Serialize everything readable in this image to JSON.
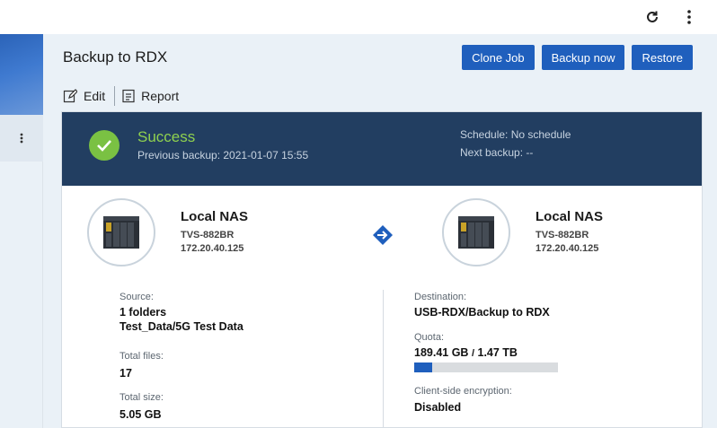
{
  "topbar": {
    "icons": [
      "refresh-icon",
      "more-vertical-icon"
    ]
  },
  "sidebar": {
    "menu_icon": "more-vertical-icon"
  },
  "job": {
    "title": "Backup to RDX",
    "actions": {
      "clone": "Clone Job",
      "backup_now": "Backup now",
      "restore": "Restore"
    },
    "tools": {
      "edit": "Edit",
      "report": "Report"
    }
  },
  "status": {
    "title": "Success",
    "previous_backup": "Previous backup: 2021-01-07 15:55",
    "schedule": "Schedule: No schedule",
    "next_backup": "Next backup: --",
    "color": "#7ac143"
  },
  "source_node": {
    "name": "Local NAS",
    "model": "TVS-882BR",
    "ip": "172.20.40.125"
  },
  "dest_node": {
    "name": "Local NAS",
    "model": "TVS-882BR",
    "ip": "172.20.40.125"
  },
  "source": {
    "label": "Source:",
    "folders": "1 folders",
    "path": "Test_Data/5G Test Data",
    "total_files_label": "Total files:",
    "total_files": "17",
    "total_size_label": "Total size:",
    "total_size": "5.05 GB"
  },
  "destination": {
    "label": "Destination:",
    "path": "USB-RDX/Backup to RDX",
    "quota_label": "Quota:",
    "quota_used": "189.41 GB",
    "quota_sep": "/",
    "quota_total": "1.47 TB",
    "quota_fraction": 0.126,
    "encryption_label": "Client-side encryption:",
    "encryption": "Disabled"
  },
  "colors": {
    "accent": "#1f5fbd",
    "status_bar": "#223e61",
    "success": "#8fd14f"
  }
}
